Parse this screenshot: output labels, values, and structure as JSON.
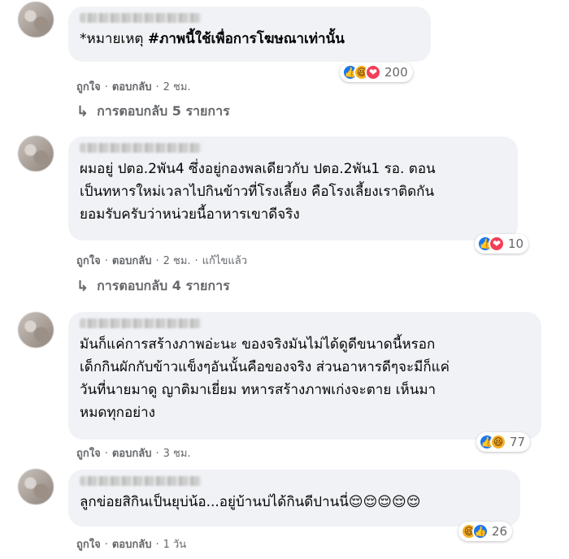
{
  "comments": [
    {
      "text_prefix": "*หมายเหตุ ",
      "text_bold": "#ภาพนี้ใช้เพื่อการโฆษณาเท่านั้น",
      "reactions": {
        "icons": [
          "like-icon",
          "haha-icon",
          "love-icon"
        ],
        "count": "200"
      },
      "meta": {
        "like": "ถูกใจ",
        "reply": "ตอบกลับ",
        "time": "2 ชม."
      },
      "replies_link": "การตอบกลับ 5 รายการ"
    },
    {
      "text": "ผมอยู่ ปตอ.2พัน4 ซึ่งอยู่กองพลเดียวกับ ปตอ.2พัน1 รอ. ตอน\nเป็นทหารใหม่เวลาไปกินข้าวที่โรงเลี้ยง คือโรงเลี้ยงเราติดกัน\nยอมรับครับว่าหน่วยนี้อาหารเขาดีจริง",
      "reactions": {
        "icons": [
          "like-icon",
          "love-icon"
        ],
        "count": "10"
      },
      "meta": {
        "like": "ถูกใจ",
        "reply": "ตอบกลับ",
        "time": "2 ชม.",
        "edited": "แก้ไขแล้ว"
      },
      "replies_link": "การตอบกลับ 4 รายการ"
    },
    {
      "text": "มันก็แค่การสร้างภาพอ่ะนะ ของจริงมันไม่ได้ดูดีขนาดนี้หรอก\nเด็กกินผักกับข้าวแข็งๆอันนั้นคือของจริง ส่วนอาหารดีๆจะมีก็แค่\nวันที่นายมาดู ญาติมาเยี่ยม ทหารสร้างภาพเก่งจะตาย เห็นมา\nหมดทุกอย่าง",
      "reactions": {
        "icons": [
          "like-icon",
          "haha-icon"
        ],
        "count": "77"
      },
      "meta": {
        "like": "ถูกใจ",
        "reply": "ตอบกลับ",
        "time": "3 ชม."
      }
    },
    {
      "text": "ลูกข่อยสิกินเป็นยุบ่น้อ...อยู่บ้านบ่ได้กินดีปานนี่😌😌😌😌😌",
      "reactions": {
        "icons": [
          "haha-icon",
          "like-icon"
        ],
        "count": "26"
      },
      "meta": {
        "like": "ถูกใจ",
        "reply": "ตอบกลับ",
        "time": "1 วัน"
      }
    }
  ]
}
